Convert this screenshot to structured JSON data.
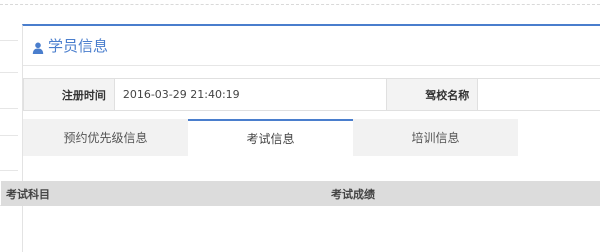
{
  "panel": {
    "title": "学员信息",
    "icon": "user-icon",
    "accent": "#4a7ecd"
  },
  "info": {
    "register_time_label": "注册时间",
    "register_time_value": "2016-03-29 21:40:19",
    "school_label": "驾校名称",
    "school_value": ""
  },
  "tabs": [
    {
      "label": "预约优先级信息",
      "active": false
    },
    {
      "label": "考试信息",
      "active": true
    },
    {
      "label": "培训信息",
      "active": false
    }
  ],
  "table": {
    "columns": [
      "考试科目",
      "考试成绩"
    ]
  }
}
